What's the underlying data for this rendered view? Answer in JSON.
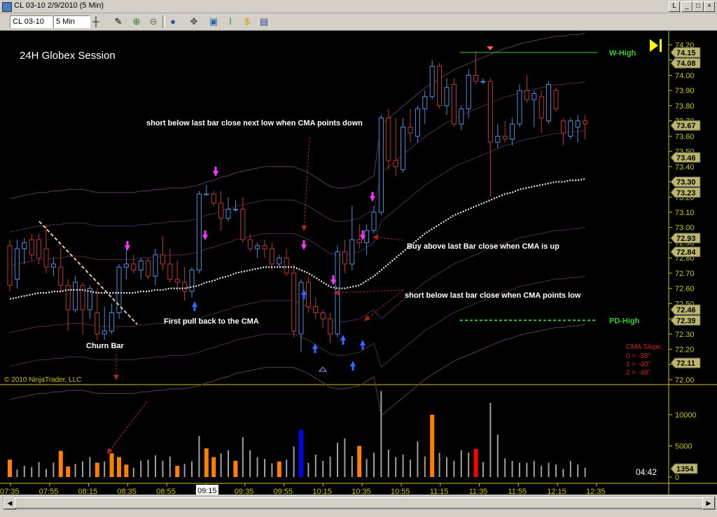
{
  "window": {
    "title": "CL 03-10  2/9/2010 (5 Min)"
  },
  "toolbar": {
    "instrument": "CL 03-10",
    "interval": "5 Min"
  },
  "chart_data": {
    "type": "candlestick",
    "title": "24H Globex Session",
    "copyright": "© 2010 NinjaTrader, LLC",
    "price_axis": {
      "range": [
        72.0,
        74.2
      ],
      "ticks": [
        "74.20",
        "74.10",
        "74.00",
        "73.90",
        "73.80",
        "73.70",
        "73.60",
        "73.50",
        "73.40",
        "73.30",
        "73.20",
        "73.10",
        "73.00",
        "72.90",
        "72.80",
        "72.70",
        "72.60",
        "72.50",
        "72.40",
        "72.30",
        "72.20",
        "72.10",
        "72.00"
      ]
    },
    "price_markers": [
      {
        "label": "74.15",
        "value": 74.15,
        "color": "#bdb76b"
      },
      {
        "label": "74.08",
        "value": 74.08,
        "color": "#bdb76b"
      },
      {
        "label": "73.67",
        "value": 73.67,
        "color": "#bdb76b"
      },
      {
        "label": "73.46",
        "value": 73.46,
        "color": "#bdb76b"
      },
      {
        "label": "73.30",
        "value": 73.3,
        "color": "#bdb76b"
      },
      {
        "label": "73.23",
        "value": 73.23,
        "color": "#bdb76b"
      },
      {
        "label": "72.93",
        "value": 72.93,
        "color": "#bdb76b"
      },
      {
        "label": "72.84",
        "value": 72.84,
        "color": "#bdb76b"
      },
      {
        "label": "72.46",
        "value": 72.46,
        "color": "#bdb76b"
      },
      {
        "label": "72.39",
        "value": 72.39,
        "color": "#bdb76b"
      },
      {
        "label": "72.11",
        "value": 72.11,
        "color": "#bdb76b"
      }
    ],
    "reference_lines": [
      {
        "label": "W-High",
        "value": 74.15,
        "color": "#33cc33",
        "style": "solid"
      },
      {
        "label": "PD-High",
        "value": 72.39,
        "color": "#33cc33",
        "style": "dashed"
      }
    ],
    "time_axis": [
      "07:35",
      "07:55",
      "08:15",
      "08:35",
      "08:55",
      "09:15",
      "09:35",
      "09:55",
      "10:15",
      "10:35",
      "10:55",
      "11:15",
      "11:35",
      "11:55",
      "12:15",
      "12:35"
    ],
    "cursor_time": "09:15",
    "annotations": [
      "short below last bar close next low when CMA points down",
      "Buy above last Bar close when CMA is up",
      "short below last bar close when CMA points low",
      "First pull back to the CMA",
      "Churn Bar"
    ],
    "slope_box": {
      "title": "CMA Slope:",
      "lines": [
        "0 = -38°",
        "1 = -40°",
        "2 = -48°"
      ]
    },
    "volume_axis": {
      "range": [
        0,
        14000
      ],
      "ticks": [
        "10000",
        "5000",
        "0"
      ]
    },
    "volume_marker": "1354",
    "countdown": "04:42",
    "candles": [
      [
        72.88,
        72.92,
        72.58,
        72.62
      ],
      [
        72.66,
        72.92,
        72.6,
        72.86
      ],
      [
        72.86,
        72.93,
        72.76,
        72.9
      ],
      [
        72.92,
        72.96,
        72.78,
        72.82
      ],
      [
        72.92,
        72.96,
        72.76,
        72.8
      ],
      [
        72.86,
        73.02,
        72.7,
        72.74
      ],
      [
        72.74,
        72.8,
        72.68,
        72.76
      ],
      [
        72.74,
        72.86,
        72.58,
        72.62
      ],
      [
        72.62,
        72.66,
        72.32,
        72.46
      ],
      [
        72.46,
        72.68,
        72.44,
        72.64
      ],
      [
        72.62,
        72.64,
        72.3,
        72.46
      ],
      [
        72.46,
        72.62,
        72.4,
        72.6
      ],
      [
        72.44,
        72.6,
        72.26,
        72.3
      ],
      [
        72.3,
        72.48,
        72.26,
        72.32
      ],
      [
        72.32,
        72.5,
        72.3,
        72.44
      ],
      [
        72.44,
        72.76,
        72.4,
        72.74
      ],
      [
        72.74,
        72.86,
        72.66,
        72.76
      ],
      [
        72.76,
        72.82,
        72.7,
        72.72
      ],
      [
        72.72,
        72.8,
        72.66,
        72.78
      ],
      [
        72.78,
        72.8,
        72.66,
        72.68
      ],
      [
        72.68,
        72.86,
        72.62,
        72.82
      ],
      [
        72.82,
        72.94,
        72.72,
        72.76
      ],
      [
        72.76,
        72.86,
        72.64,
        72.66
      ],
      [
        72.66,
        72.78,
        72.58,
        72.64
      ],
      [
        72.64,
        72.74,
        72.52,
        72.58
      ],
      [
        72.58,
        72.74,
        72.54,
        72.72
      ],
      [
        72.72,
        73.24,
        72.7,
        73.22
      ],
      [
        73.22,
        73.28,
        73.22,
        73.22
      ],
      [
        73.22,
        73.24,
        73.14,
        73.16
      ],
      [
        73.16,
        73.24,
        72.98,
        73.06
      ],
      [
        73.06,
        73.2,
        73.04,
        73.12
      ],
      [
        73.12,
        73.18,
        73.1,
        73.12
      ],
      [
        73.12,
        73.2,
        72.9,
        72.92
      ],
      [
        72.92,
        72.96,
        72.84,
        72.86
      ],
      [
        72.86,
        72.9,
        72.8,
        72.88
      ],
      [
        72.88,
        72.92,
        72.8,
        72.86
      ],
      [
        72.86,
        72.9,
        72.72,
        72.76
      ],
      [
        72.76,
        72.82,
        72.74,
        72.8
      ],
      [
        72.8,
        72.86,
        72.68,
        72.7
      ],
      [
        72.7,
        72.76,
        72.28,
        72.32
      ],
      [
        72.3,
        72.66,
        72.18,
        72.64
      ],
      [
        72.64,
        72.68,
        72.44,
        72.48
      ],
      [
        72.48,
        72.54,
        72.4,
        72.44
      ],
      [
        72.44,
        72.46,
        72.34,
        72.4
      ],
      [
        72.4,
        72.44,
        72.24,
        72.3
      ],
      [
        72.3,
        72.88,
        72.28,
        72.84
      ],
      [
        72.84,
        72.92,
        72.7,
        72.76
      ],
      [
        72.76,
        73.14,
        72.72,
        72.92
      ],
      [
        72.92,
        73.02,
        72.86,
        72.9
      ],
      [
        72.9,
        73.02,
        72.82,
        72.98
      ],
      [
        72.98,
        73.14,
        72.96,
        73.1
      ],
      [
        73.1,
        73.74,
        73.08,
        73.72
      ],
      [
        73.72,
        73.78,
        73.38,
        73.44
      ],
      [
        73.44,
        73.72,
        73.34,
        73.4
      ],
      [
        73.38,
        73.72,
        73.36,
        73.66
      ],
      [
        73.66,
        73.78,
        73.56,
        73.62
      ],
      [
        73.6,
        73.8,
        73.56,
        73.78
      ],
      [
        73.78,
        73.9,
        73.68,
        73.86
      ],
      [
        73.86,
        74.1,
        73.84,
        74.06
      ],
      [
        74.06,
        74.08,
        73.78,
        73.8
      ],
      [
        73.8,
        73.98,
        73.74,
        73.92
      ],
      [
        73.94,
        73.98,
        73.66,
        73.68
      ],
      [
        73.68,
        73.8,
        73.64,
        73.78
      ],
      [
        73.78,
        74.04,
        73.72,
        74.0
      ],
      [
        74.0,
        74.16,
        73.94,
        73.96
      ],
      [
        73.96,
        73.98,
        73.94,
        73.96
      ],
      [
        73.96,
        73.98,
        73.2,
        73.56
      ],
      [
        73.56,
        73.68,
        73.52,
        73.6
      ],
      [
        73.6,
        73.7,
        73.56,
        73.58
      ],
      [
        73.58,
        73.72,
        73.54,
        73.68
      ],
      [
        73.68,
        73.94,
        73.66,
        73.9
      ],
      [
        73.9,
        74.0,
        73.82,
        73.84
      ],
      [
        73.84,
        73.9,
        73.66,
        73.88
      ],
      [
        73.86,
        73.9,
        73.62,
        73.72
      ],
      [
        73.7,
        73.96,
        73.68,
        73.94
      ],
      [
        73.9,
        73.92,
        73.76,
        73.78
      ],
      [
        73.7,
        73.72,
        73.54,
        73.62
      ],
      [
        73.6,
        73.72,
        73.58,
        73.7
      ],
      [
        73.66,
        73.74,
        73.56,
        73.7
      ],
      [
        73.7,
        73.74,
        73.58,
        73.68
      ]
    ],
    "cma": [
      72.53,
      72.54,
      72.55,
      72.56,
      72.57,
      72.57,
      72.58,
      72.58,
      72.59,
      72.59,
      72.59,
      72.58,
      72.57,
      72.57,
      72.57,
      72.57,
      72.57,
      72.57,
      72.58,
      72.58,
      72.59,
      72.59,
      72.6,
      72.6,
      72.6,
      72.61,
      72.62,
      72.64,
      72.65,
      72.67,
      72.68,
      72.7,
      72.71,
      72.72,
      72.73,
      72.74,
      72.74,
      72.74,
      72.74,
      72.74,
      72.72,
      72.7,
      72.67,
      72.64,
      72.61,
      72.6,
      72.6,
      72.61,
      72.62,
      72.65,
      72.68,
      72.72,
      72.76,
      72.8,
      72.84,
      72.88,
      72.92,
      72.96,
      72.99,
      73.02,
      73.05,
      73.08,
      73.1,
      73.12,
      73.14,
      73.16,
      73.18,
      73.2,
      73.22,
      73.23,
      73.25,
      73.26,
      73.27,
      73.28,
      73.29,
      73.3,
      73.3,
      73.31,
      73.31,
      73.32
    ],
    "volume": [
      {
        "v": 2800,
        "c": "orange"
      },
      {
        "v": 1200,
        "c": "gray"
      },
      {
        "v": 1800,
        "c": "gray"
      },
      {
        "v": 1600,
        "c": "gray"
      },
      {
        "v": 2400,
        "c": "gray"
      },
      {
        "v": 1300,
        "c": "gray"
      },
      {
        "v": 2300,
        "c": "gray"
      },
      {
        "v": 4200,
        "c": "orange"
      },
      {
        "v": 1700,
        "c": "orange"
      },
      {
        "v": 2100,
        "c": "gray"
      },
      {
        "v": 2500,
        "c": "gray"
      },
      {
        "v": 3200,
        "c": "gray"
      },
      {
        "v": 2300,
        "c": "orange"
      },
      {
        "v": 2500,
        "c": "gray"
      },
      {
        "v": 3800,
        "c": "orange"
      },
      {
        "v": 3200,
        "c": "orange"
      },
      {
        "v": 2000,
        "c": "orange"
      },
      {
        "v": 1500,
        "c": "gray"
      },
      {
        "v": 2600,
        "c": "gray"
      },
      {
        "v": 2800,
        "c": "gray"
      },
      {
        "v": 3500,
        "c": "gray"
      },
      {
        "v": 2600,
        "c": "gray"
      },
      {
        "v": 3300,
        "c": "gray"
      },
      {
        "v": 1800,
        "c": "orange"
      },
      {
        "v": 2100,
        "c": "gray"
      },
      {
        "v": 2500,
        "c": "gray"
      },
      {
        "v": 6600,
        "c": "gray"
      },
      {
        "v": 4600,
        "c": "orange"
      },
      {
        "v": 3200,
        "c": "orange"
      },
      {
        "v": 3800,
        "c": "gray"
      },
      {
        "v": 4300,
        "c": "gray"
      },
      {
        "v": 2600,
        "c": "orange"
      },
      {
        "v": 6400,
        "c": "gray"
      },
      {
        "v": 4300,
        "c": "gray"
      },
      {
        "v": 3200,
        "c": "gray"
      },
      {
        "v": 2900,
        "c": "gray"
      },
      {
        "v": 2200,
        "c": "gray"
      },
      {
        "v": 2500,
        "c": "orange"
      },
      {
        "v": 2800,
        "c": "gray"
      },
      {
        "v": 4900,
        "c": "gray"
      },
      {
        "v": 7600,
        "c": "blue"
      },
      {
        "v": 2300,
        "c": "gray"
      },
      {
        "v": 3600,
        "c": "gray"
      },
      {
        "v": 2600,
        "c": "gray"
      },
      {
        "v": 3300,
        "c": "gray"
      },
      {
        "v": 5500,
        "c": "gray"
      },
      {
        "v": 6200,
        "c": "gray"
      },
      {
        "v": 3400,
        "c": "gray"
      },
      {
        "v": 5000,
        "c": "orange"
      },
      {
        "v": 2900,
        "c": "gray"
      },
      {
        "v": 3900,
        "c": "gray"
      },
      {
        "v": 13800,
        "c": "gray"
      },
      {
        "v": 4400,
        "c": "gray"
      },
      {
        "v": 3200,
        "c": "gray"
      },
      {
        "v": 3600,
        "c": "gray"
      },
      {
        "v": 2800,
        "c": "gray"
      },
      {
        "v": 5700,
        "c": "gray"
      },
      {
        "v": 3300,
        "c": "gray"
      },
      {
        "v": 10000,
        "c": "orange"
      },
      {
        "v": 3900,
        "c": "gray"
      },
      {
        "v": 3200,
        "c": "gray"
      },
      {
        "v": 2600,
        "c": "gray"
      },
      {
        "v": 4300,
        "c": "gray"
      },
      {
        "v": 3900,
        "c": "gray"
      },
      {
        "v": 4500,
        "c": "red"
      },
      {
        "v": 2400,
        "c": "gray"
      },
      {
        "v": 11900,
        "c": "gray"
      },
      {
        "v": 6800,
        "c": "gray"
      },
      {
        "v": 3000,
        "c": "gray"
      },
      {
        "v": 2600,
        "c": "gray"
      },
      {
        "v": 2300,
        "c": "gray"
      },
      {
        "v": 2300,
        "c": "gray"
      },
      {
        "v": 2600,
        "c": "gray"
      },
      {
        "v": 1800,
        "c": "gray"
      },
      {
        "v": 2300,
        "c": "gray"
      },
      {
        "v": 2000,
        "c": "gray"
      },
      {
        "v": 1300,
        "c": "gray"
      },
      {
        "v": 2600,
        "c": "gray"
      },
      {
        "v": 2000,
        "c": "gray"
      },
      {
        "v": 1500,
        "c": "gray"
      }
    ]
  }
}
